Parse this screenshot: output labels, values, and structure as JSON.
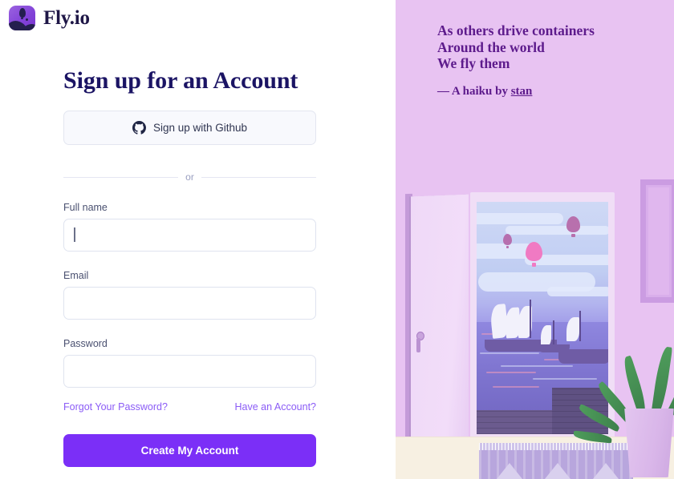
{
  "brand": {
    "name": "Fly.io",
    "logo_icon": "balloon-logo-icon",
    "logo_bg": "#8243d8"
  },
  "left_panel": {
    "title": "Sign up for an Account",
    "oauth": {
      "label": "Sign up with Github",
      "icon": "github-icon"
    },
    "divider_text": "or",
    "fields": [
      {
        "label": "Full name",
        "value": "",
        "placeholder": "",
        "type": "text",
        "focused": true
      },
      {
        "label": "Email",
        "value": "",
        "placeholder": "",
        "type": "email",
        "focused": false
      },
      {
        "label": "Password",
        "value": "",
        "placeholder": "",
        "type": "password",
        "focused": false
      }
    ],
    "links": {
      "forgot": "Forgot Your Password?",
      "have_account": "Have an Account?"
    },
    "submit_label": "Create My Account",
    "accent_color": "#7b2ff7",
    "link_color": "#8b5cf6"
  },
  "right_panel": {
    "background_color": "#e8c3f2",
    "text_color": "#5d1b8c",
    "haiku": [
      "As others drive containers",
      "Around the world",
      "We fly them"
    ],
    "attribution_prefix": "— A haiku by ",
    "attribution_author": "stan",
    "illustration": {
      "name": "open-door-harbor-illustration",
      "elements": [
        "open-door",
        "doorway-view",
        "sailing-ships",
        "hot-air-balloons",
        "sea",
        "dock",
        "potted-plant",
        "picture-frame",
        "rug"
      ]
    }
  }
}
